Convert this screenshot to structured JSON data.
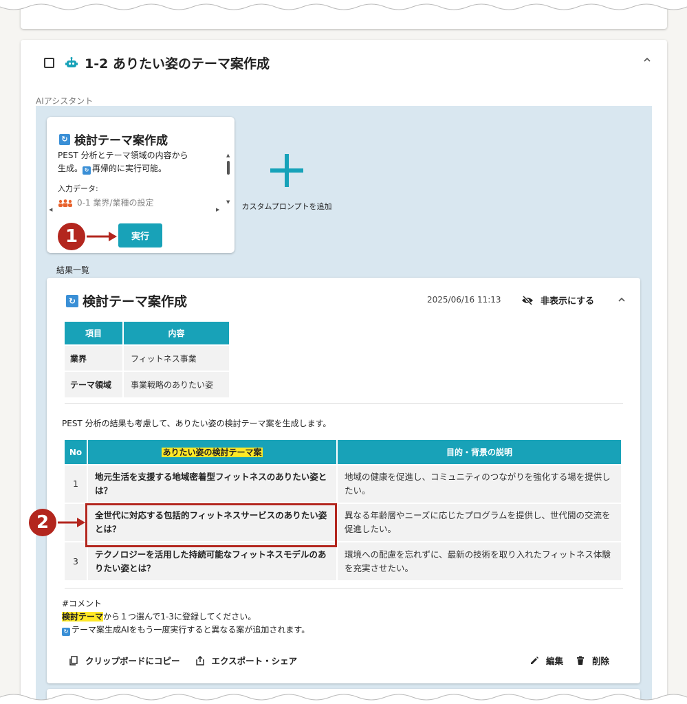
{
  "section": {
    "title": "1-2 ありたい姿のテーマ案作成",
    "ai_assistant_label": "AIアシスタント",
    "results_label": "結果一覧"
  },
  "prompt_card": {
    "title": "検討テーマ案作成",
    "desc_line1": "PEST 分析とテーマ領域の内容から",
    "desc_line2_prefix": "生成。",
    "desc_line2_suffix": "再帰的に実行可能。",
    "input_label": "入力データ:",
    "input_item": "0-1 業界/業種の設定",
    "run_label": "実行"
  },
  "add_prompt": {
    "label": "カスタムプロンプトを追加"
  },
  "result": {
    "title": "検討テーマ案作成",
    "timestamp": "2025/06/16 11:13",
    "hide_label": "非表示にする",
    "info_headers": [
      "項目",
      "内容"
    ],
    "info_rows": [
      {
        "key": "業界",
        "value": "フィットネス事業"
      },
      {
        "key": "テーマ領域",
        "value": "事業戦略のありたい姿"
      }
    ],
    "pest_note": "PEST 分析の結果も考慮して、ありたい姿の検討テーマ案を生成します。",
    "theme_headers": [
      "No",
      "ありたい姿の検討テーマ案",
      "目的・背景の説明"
    ],
    "theme_rows": [
      {
        "no": "1",
        "theme": "地元生活を支援する地域密着型フィットネスのありたい姿とは？",
        "purpose": "地域の健康を促進し、コミュニティのつながりを強化する場を提供したい。"
      },
      {
        "no": "",
        "theme": "全世代に対応する包括的フィットネスサービスのありたい姿とは？",
        "purpose": "異なる年齢層やニーズに応じたプログラムを提供し、世代間の交流を促進したい。"
      },
      {
        "no": "3",
        "theme": "テクノロジーを活用した持続可能なフィットネスモデルのありたい姿とは？",
        "purpose": "環境への配慮を忘れずに、最新の技術を取り入れたフィットネス体験を充実させたい。"
      }
    ],
    "comment_heading": "#コメント",
    "comment_hl": "検討テーマ",
    "comment_line1_rest": "から１つ選んで1-3に登録してください。",
    "comment_line2": "テーマ案生成AIをもう一度実行すると異なる案が追加されます。",
    "copy_label": "クリップボードにコピー",
    "export_label": "エクスポート・シェア",
    "edit_label": "編集",
    "delete_label": "削除"
  },
  "annotations": {
    "marker1": "1",
    "marker2": "2"
  },
  "colors": {
    "accent": "#18a2b8",
    "annotation": "#b3261e",
    "highlight": "#ffe827",
    "panel": "#d9e7f0"
  },
  "icons": [
    "robot-icon",
    "ai-badge-icon",
    "people-icon",
    "plus-icon",
    "eye-off-icon",
    "chevron-up-icon",
    "clipboard-icon",
    "share-icon",
    "pencil-icon",
    "trash-icon"
  ]
}
